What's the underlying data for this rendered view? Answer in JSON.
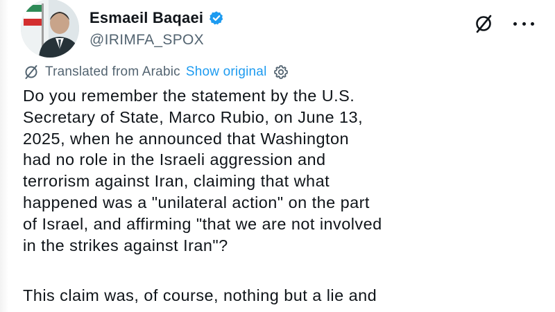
{
  "author": {
    "name": "Esmaeil Baqaei",
    "handle": "@IRIMFA_SPOX",
    "verified": true,
    "verified_color": "#1d9bf0"
  },
  "header_actions": {
    "grok_icon": "grok-icon",
    "more_icon": "more-horizontal-icon"
  },
  "translation": {
    "label": "Translated from Arabic",
    "show_original": "Show original",
    "icon": "globe-icon",
    "settings_icon": "gear-icon"
  },
  "tweet": {
    "paragraph1_lines": [
      "Do you remember the statement by the U.S.",
      "Secretary of State, Marco Rubio, on June 13,",
      "2025, when he announced that Washington",
      "had no role in the Israeli aggression and",
      "terrorism against Iran, claiming that what",
      "happened was a \"unilateral action\" on the part",
      "of Israel, and affirming \"that we are not involved",
      "in the strikes against Iran\"?"
    ],
    "paragraph2_line": "This claim was, of course, nothing but a lie and"
  },
  "colors": {
    "text": "#0f1419",
    "secondary_text": "#536471",
    "link": "#1d9bf0"
  }
}
